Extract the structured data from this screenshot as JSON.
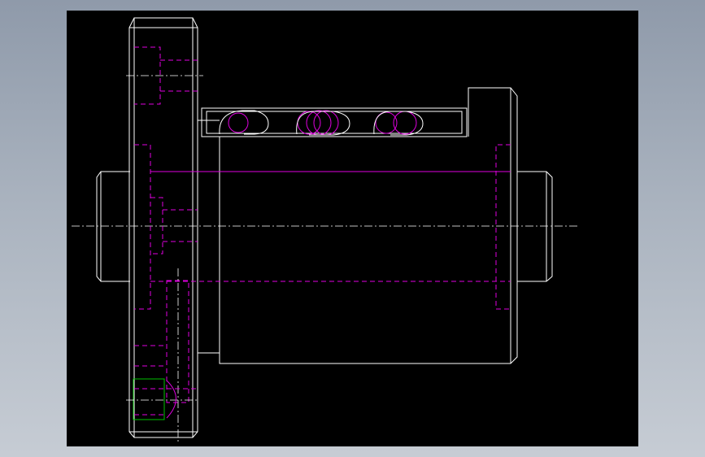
{
  "viewport": {
    "background": "#000000",
    "app_background": "#aab3bf"
  },
  "colors": {
    "outline": "#ffffff",
    "hidden_lines": "#e000e0",
    "selection": "#00c000"
  }
}
